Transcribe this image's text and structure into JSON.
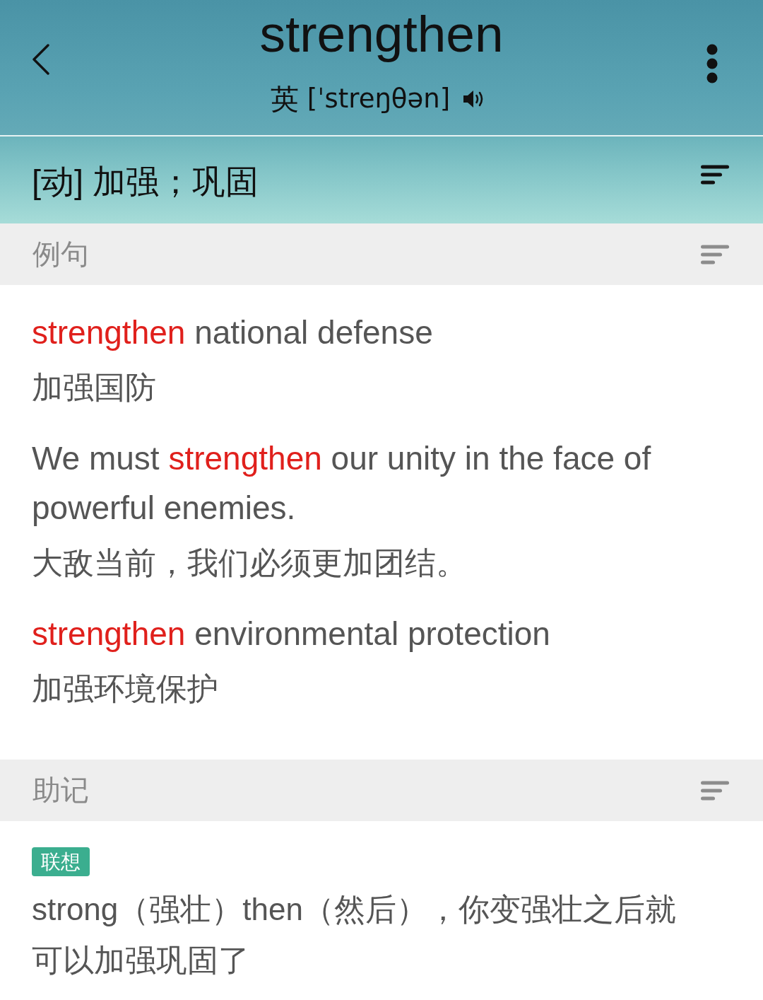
{
  "header": {
    "word": "strengthen",
    "phonetic": {
      "accent": "英",
      "ipa": "[ˈstreŋθən]"
    }
  },
  "definition": {
    "text": "[动] 加强；巩固"
  },
  "sections": [
    {
      "kind": "examples",
      "title": "例句",
      "examples": [
        {
          "en": [
            {
              "text": "strengthen",
              "highlight": true
            },
            {
              "text": " national defense",
              "highlight": false
            }
          ],
          "zh": "加强国防"
        },
        {
          "en": [
            {
              "text": "We must ",
              "highlight": false
            },
            {
              "text": "strengthen",
              "highlight": true
            },
            {
              "text": " our unity in the face of powerful enemies.",
              "highlight": false
            }
          ],
          "zh": "大敌当前，我们必须更加团结。"
        },
        {
          "en": [
            {
              "text": "strengthen",
              "highlight": true
            },
            {
              "text": " environmental protection",
              "highlight": false
            }
          ],
          "zh": "加强环境保护"
        }
      ]
    },
    {
      "kind": "mnemonic",
      "title": "助记",
      "tag": "联想",
      "text": "strong（强壮）then（然后），你变强壮之后就可以加强巩固了"
    }
  ]
}
